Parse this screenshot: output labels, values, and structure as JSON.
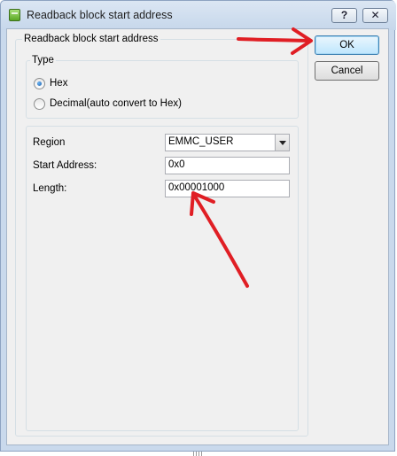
{
  "window": {
    "title": "Readback block start address",
    "help_label": "?",
    "close_label": "✕"
  },
  "dialog": {
    "group_label": "Readback block start address",
    "type": {
      "label": "Type",
      "options": [
        {
          "label": "Hex",
          "checked": true
        },
        {
          "label": "Decimal(auto convert to Hex)",
          "checked": false
        }
      ]
    },
    "region": {
      "label": "Region",
      "value": "EMMC_USER"
    },
    "start_address": {
      "label": "Start Address:",
      "value": "0x0"
    },
    "length": {
      "label": "Length:",
      "value": "0x00001000"
    }
  },
  "buttons": {
    "ok": "OK",
    "cancel": "Cancel"
  },
  "annotation_color": "#e01e24"
}
